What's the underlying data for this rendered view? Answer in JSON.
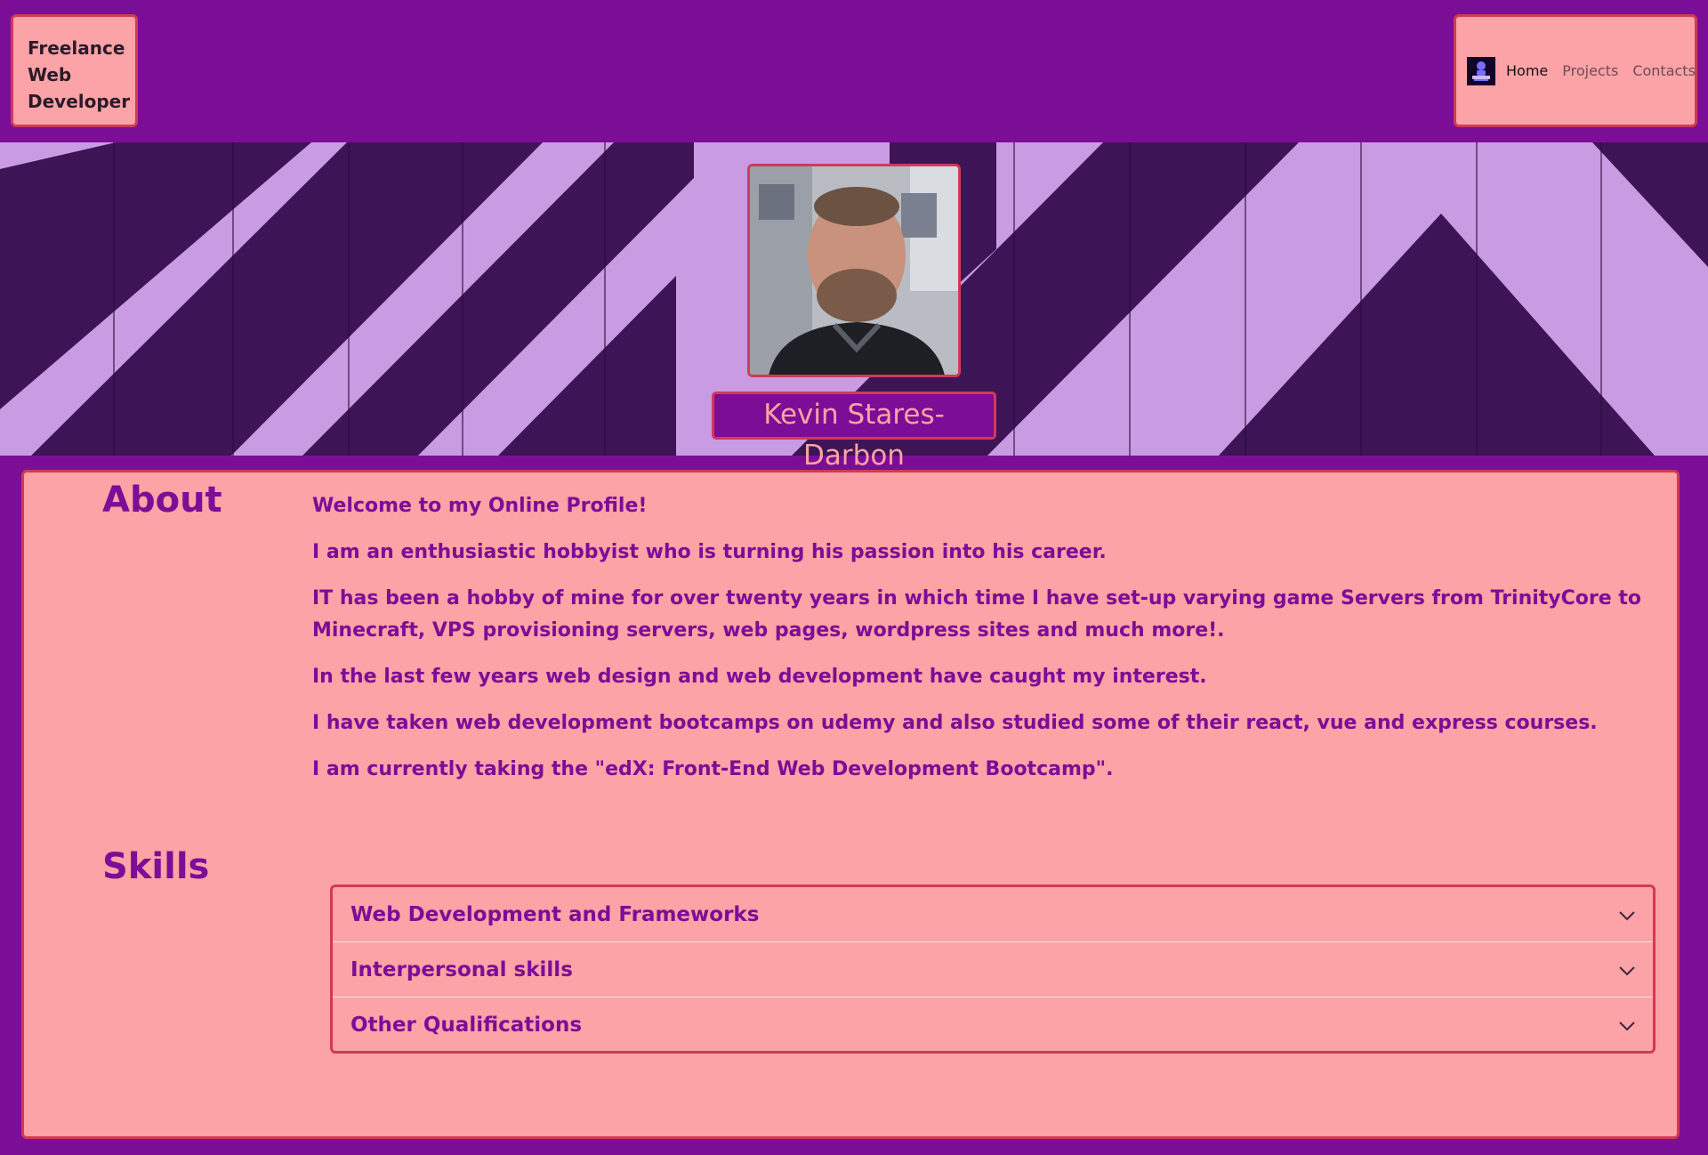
{
  "header": {
    "brand": [
      "Freelance",
      "Web",
      "Developer"
    ],
    "nav": [
      {
        "label": "Home",
        "active": true
      },
      {
        "label": "Projects",
        "active": false
      },
      {
        "label": "Contacts",
        "active": false
      }
    ],
    "logo_icon": "person-silhouette-icon"
  },
  "hero": {
    "name": "Kevin Stares-Darbon"
  },
  "about": {
    "title": "About",
    "paragraphs": [
      "Welcome to my Online Profile!",
      "I am an enthusiastic hobbyist who is turning his passion into his career.",
      "IT has been a hobby of mine for over twenty years in which time I have set-up varying game Servers from TrinityCore to Minecraft, VPS provisioning servers, web pages, wordpress sites and much more!.",
      "In the last few years web design and web development have caught my interest.",
      "I have taken web development bootcamps on udemy and also studied some of their react, vue and express courses.",
      "I am currently taking the \"edX: Front-End Web Development Bootcamp\"."
    ]
  },
  "skills": {
    "title": "Skills",
    "items": [
      {
        "label": "Web Development and Frameworks",
        "icon": "chevron-down-icon"
      },
      {
        "label": "Interpersonal skills",
        "icon": "chevron-down-icon"
      },
      {
        "label": "Other Qualifications",
        "icon": "chevron-down-icon"
      }
    ]
  },
  "colors": {
    "background": "#7b0e96",
    "panel": "#fba3a6",
    "border": "#d13a56",
    "text": "#7b0e96"
  }
}
